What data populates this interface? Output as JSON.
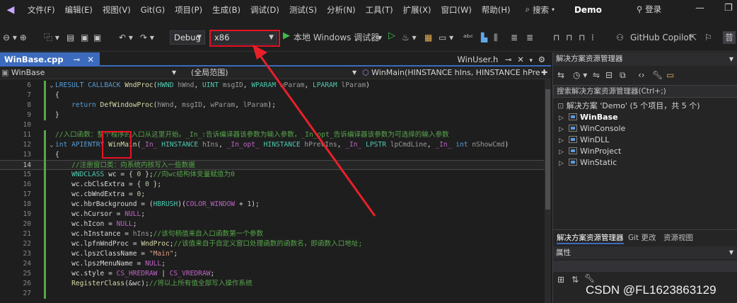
{
  "menu": {
    "items": [
      "文件(F)",
      "编辑(E)",
      "视图(V)",
      "Git(G)",
      "项目(P)",
      "生成(B)",
      "调试(D)",
      "测试(S)",
      "分析(N)",
      "工具(T)",
      "扩展(X)",
      "窗口(W)",
      "帮助(H)"
    ],
    "search": "搜索",
    "solution": "Demo",
    "login": "登录"
  },
  "toolbar": {
    "config": "Debug",
    "platform": "x86",
    "run_label": "本地 Windows 调试器",
    "copilot": "GitHub Copilot",
    "extra": "昔"
  },
  "editor": {
    "active_tab": "WinBase.cpp",
    "right_tab": "WinUser.h",
    "nav_project": "WinBase",
    "nav_scope": "(全局范围)",
    "nav_function": "WinMain(HINSTANCE hIns, HINSTANCE hPrev"
  },
  "code_lines": [
    {
      "n": "6",
      "segs": [
        [
          "kw",
          "LRESULT"
        ],
        [
          "txt",
          " "
        ],
        [
          "kw",
          "CALLBACK"
        ],
        [
          "txt",
          " "
        ],
        [
          "fn",
          "WndProc"
        ],
        [
          "txt",
          "("
        ],
        [
          "ty",
          "HWND"
        ],
        [
          "txt",
          " "
        ],
        [
          "par",
          "hWnd"
        ],
        [
          "txt",
          ", "
        ],
        [
          "ty",
          "UINT"
        ],
        [
          "txt",
          " "
        ],
        [
          "par",
          "msgID"
        ],
        [
          "txt",
          ", "
        ],
        [
          "ty",
          "WPARAM"
        ],
        [
          "txt",
          " "
        ],
        [
          "par",
          "wParam"
        ],
        [
          "txt",
          ", "
        ],
        [
          "ty",
          "LPARAM"
        ],
        [
          "txt",
          " "
        ],
        [
          "par",
          "lParam"
        ],
        [
          "txt",
          ")"
        ]
      ]
    },
    {
      "n": "7",
      "segs": [
        [
          "txt",
          "{"
        ]
      ]
    },
    {
      "n": "8",
      "segs": [
        [
          "txt",
          "    "
        ],
        [
          "kw",
          "return"
        ],
        [
          "txt",
          " "
        ],
        [
          "fn",
          "DefWindowProc"
        ],
        [
          "txt",
          "("
        ],
        [
          "par",
          "hWnd"
        ],
        [
          "txt",
          ", "
        ],
        [
          "par",
          "msgID"
        ],
        [
          "txt",
          ", "
        ],
        [
          "par",
          "wParam"
        ],
        [
          "txt",
          ", "
        ],
        [
          "par",
          "lParam"
        ],
        [
          "txt",
          ");"
        ]
      ]
    },
    {
      "n": "9",
      "segs": [
        [
          "txt",
          "}"
        ]
      ]
    },
    {
      "n": "10",
      "segs": []
    },
    {
      "n": "11",
      "segs": [
        [
          "cm",
          "//入口函数：整个程序的入口从这里开始。_In_:告诉编译器该参数为输入参数，_In_opt_告诉编译器该参数为可选择的输入参数"
        ]
      ]
    },
    {
      "n": "12",
      "segs": [
        [
          "kw",
          "int"
        ],
        [
          "txt",
          " "
        ],
        [
          "kw",
          "APIENTRY"
        ],
        [
          "txt",
          " "
        ],
        [
          "fn",
          "WinMain"
        ],
        [
          "txt",
          "("
        ],
        [
          "mac",
          "_In_"
        ],
        [
          "txt",
          " "
        ],
        [
          "ty",
          "HINSTANCE"
        ],
        [
          "txt",
          " "
        ],
        [
          "par",
          "hIns"
        ],
        [
          "txt",
          ", "
        ],
        [
          "mac",
          "_In_opt_"
        ],
        [
          "txt",
          " "
        ],
        [
          "ty",
          "HINSTANCE"
        ],
        [
          "txt",
          " "
        ],
        [
          "par",
          "hPrevIns"
        ],
        [
          "txt",
          ", "
        ],
        [
          "mac",
          "_In_"
        ],
        [
          "txt",
          " "
        ],
        [
          "ty",
          "LPSTR"
        ],
        [
          "txt",
          " "
        ],
        [
          "par",
          "lpCmdLine"
        ],
        [
          "txt",
          ", "
        ],
        [
          "mac",
          "_In_"
        ],
        [
          "txt",
          " "
        ],
        [
          "kw",
          "int"
        ],
        [
          "txt",
          " "
        ],
        [
          "par",
          "nShowCmd"
        ],
        [
          "txt",
          ")"
        ]
      ]
    },
    {
      "n": "13",
      "segs": [
        [
          "txt",
          "{"
        ]
      ]
    },
    {
      "n": "14",
      "segs": [
        [
          "txt",
          "    "
        ],
        [
          "cm",
          "//注册窗口类：向系统内核写入一些数据"
        ]
      ]
    },
    {
      "n": "15",
      "segs": [
        [
          "txt",
          "    "
        ],
        [
          "ty",
          "WNDCLASS"
        ],
        [
          "txt",
          " wc = { "
        ],
        [
          "num",
          "0"
        ],
        [
          "txt",
          " };"
        ],
        [
          "cm",
          "//向wc结构体变量赋值为0"
        ]
      ]
    },
    {
      "n": "16",
      "segs": [
        [
          "txt",
          "    wc."
        ],
        [
          "fld",
          "cbClsExtra"
        ],
        [
          "txt",
          " = { "
        ],
        [
          "num",
          "0"
        ],
        [
          "txt",
          " };"
        ]
      ]
    },
    {
      "n": "17",
      "segs": [
        [
          "txt",
          "    wc."
        ],
        [
          "fld",
          "cbWndExtra"
        ],
        [
          "txt",
          " = "
        ],
        [
          "num",
          "0"
        ],
        [
          "txt",
          ";"
        ]
      ]
    },
    {
      "n": "18",
      "segs": [
        [
          "txt",
          "    wc."
        ],
        [
          "fld",
          "hbrBackground"
        ],
        [
          "txt",
          " = ("
        ],
        [
          "ty",
          "HBRUSH"
        ],
        [
          "txt",
          ")("
        ],
        [
          "mac",
          "COLOR_WINDOW"
        ],
        [
          "txt",
          " + "
        ],
        [
          "num",
          "1"
        ],
        [
          "txt",
          ");"
        ]
      ]
    },
    {
      "n": "19",
      "segs": [
        [
          "txt",
          "    wc."
        ],
        [
          "fld",
          "hCursor"
        ],
        [
          "txt",
          " = "
        ],
        [
          "mac",
          "NULL"
        ],
        [
          "txt",
          ";"
        ]
      ]
    },
    {
      "n": "20",
      "segs": [
        [
          "txt",
          "    wc."
        ],
        [
          "fld",
          "hIcon"
        ],
        [
          "txt",
          " = "
        ],
        [
          "mac",
          "NULL"
        ],
        [
          "txt",
          ";"
        ]
      ]
    },
    {
      "n": "21",
      "segs": [
        [
          "txt",
          "    wc."
        ],
        [
          "fld",
          "hInstance"
        ],
        [
          "txt",
          " = "
        ],
        [
          "par",
          "hIns"
        ],
        [
          "txt",
          ";"
        ],
        [
          "cm",
          "//该句柄值来自入口函数第一个参数"
        ]
      ]
    },
    {
      "n": "22",
      "segs": [
        [
          "txt",
          "    wc."
        ],
        [
          "fld",
          "lpfnWndProc"
        ],
        [
          "txt",
          " = "
        ],
        [
          "fn",
          "WndProc"
        ],
        [
          "txt",
          ";"
        ],
        [
          "cm",
          "//该值来自于自定义窗口处理函数的函数名，即函数入口地址;"
        ]
      ]
    },
    {
      "n": "23",
      "segs": [
        [
          "txt",
          "    wc."
        ],
        [
          "fld",
          "lpszClassName"
        ],
        [
          "txt",
          " = "
        ],
        [
          "str",
          "\"Main\""
        ],
        [
          "txt",
          ";"
        ]
      ]
    },
    {
      "n": "24",
      "segs": [
        [
          "txt",
          "    wc."
        ],
        [
          "fld",
          "lpszMenuName"
        ],
        [
          "txt",
          " = "
        ],
        [
          "mac",
          "NULL"
        ],
        [
          "txt",
          ";"
        ]
      ]
    },
    {
      "n": "25",
      "segs": [
        [
          "txt",
          "    wc."
        ],
        [
          "fld",
          "style"
        ],
        [
          "txt",
          " = "
        ],
        [
          "mac",
          "CS_HREDRAW"
        ],
        [
          "txt",
          " | "
        ],
        [
          "mac",
          "CS_VREDRAW"
        ],
        [
          "txt",
          ";"
        ]
      ]
    },
    {
      "n": "26",
      "segs": [
        [
          "txt",
          "    "
        ],
        [
          "fn",
          "RegisterClass"
        ],
        [
          "txt",
          "(&wc);"
        ],
        [
          "cm",
          "//将以上所有值全部写入操作系统"
        ]
      ]
    },
    {
      "n": "27",
      "segs": []
    }
  ],
  "solution_explorer": {
    "title": "解决方案资源管理器",
    "search": "搜索解决方案资源管理器(Ctrl+;)",
    "solution_node": "解决方案 'Demo' (5 个项目，共 5 个)",
    "projects": [
      "WinBase",
      "WinConsole",
      "WinDLL",
      "WinProject",
      "WinStatic"
    ],
    "bottom_tabs": [
      "解决方案资源管理器",
      "Git 更改",
      "资源视图"
    ]
  },
  "properties": {
    "title": "属性"
  },
  "watermark": "CSDN @FL1623863129",
  "colors": {
    "accent": "#3c6bbd",
    "highlight_box": "#e81123",
    "arrow": "#e8202a"
  }
}
